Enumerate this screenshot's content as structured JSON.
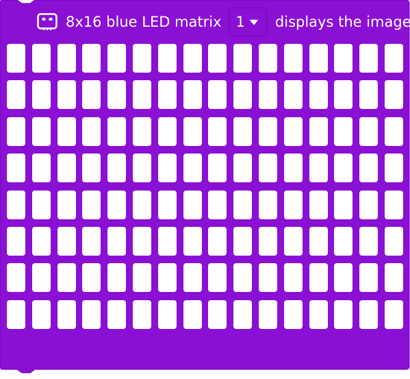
{
  "block": {
    "title": "8x16 blue LED matrix",
    "port_value": "1",
    "suffix": "displays the image",
    "device_icon": "led-matrix-board-icon",
    "dropdown_icon": "caret-down-icon"
  },
  "matrix": {
    "rows": 8,
    "cols": 16,
    "lit_leds": []
  },
  "colors": {
    "block_fill": "#8a10d3",
    "block_border": "#7000b8",
    "text": "#ffffff",
    "led_off": "#ffffff"
  }
}
